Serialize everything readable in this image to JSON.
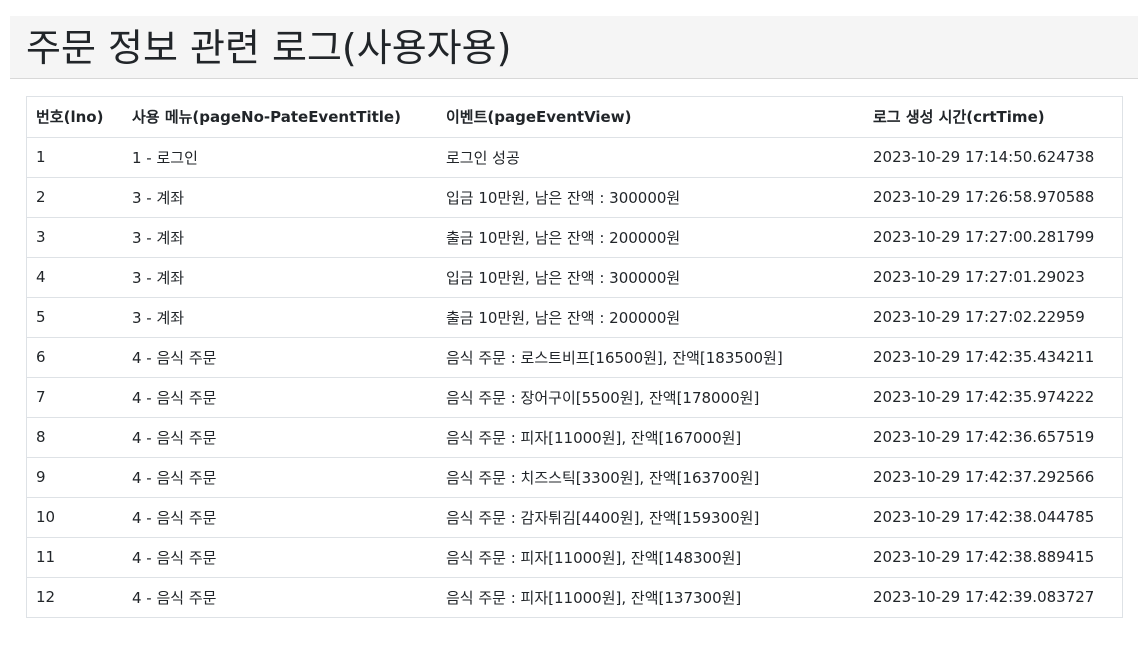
{
  "page": {
    "title": "주문 정보 관련 로그(사용자용)"
  },
  "table": {
    "headers": [
      "번호(lno)",
      "사용 메뉴(pageNo-PateEventTitle)",
      "이벤트(pageEventView)",
      "로그 생성 시간(crtTime)"
    ],
    "rows": [
      [
        "1",
        "1 - 로그인",
        "로그인 성공",
        "2023-10-29 17:14:50.624738"
      ],
      [
        "2",
        "3 - 계좌",
        "입금 10만원, 남은 잔액 : 300000원",
        "2023-10-29 17:26:58.970588"
      ],
      [
        "3",
        "3 - 계좌",
        "출금 10만원, 남은 잔액 : 200000원",
        "2023-10-29 17:27:00.281799"
      ],
      [
        "4",
        "3 - 계좌",
        "입금 10만원, 남은 잔액 : 300000원",
        "2023-10-29 17:27:01.29023"
      ],
      [
        "5",
        "3 - 계좌",
        "출금 10만원, 남은 잔액 : 200000원",
        "2023-10-29 17:27:02.22959"
      ],
      [
        "6",
        "4 - 음식 주문",
        "음식 주문 : 로스트비프[16500원], 잔액[183500원]",
        "2023-10-29 17:42:35.434211"
      ],
      [
        "7",
        "4 - 음식 주문",
        "음식 주문 : 장어구이[5500원], 잔액[178000원]",
        "2023-10-29 17:42:35.974222"
      ],
      [
        "8",
        "4 - 음식 주문",
        "음식 주문 : 피자[11000원], 잔액[167000원]",
        "2023-10-29 17:42:36.657519"
      ],
      [
        "9",
        "4 - 음식 주문",
        "음식 주문 : 치즈스틱[3300원], 잔액[163700원]",
        "2023-10-29 17:42:37.292566"
      ],
      [
        "10",
        "4 - 음식 주문",
        "음식 주문 : 감자튀김[4400원], 잔액[159300원]",
        "2023-10-29 17:42:38.044785"
      ],
      [
        "11",
        "4 - 음식 주문",
        "음식 주문 : 피자[11000원], 잔액[148300원]",
        "2023-10-29 17:42:38.889415"
      ],
      [
        "12",
        "4 - 음식 주문",
        "음식 주문 : 피자[11000원], 잔액[137300원]",
        "2023-10-29 17:42:39.083727"
      ]
    ]
  }
}
